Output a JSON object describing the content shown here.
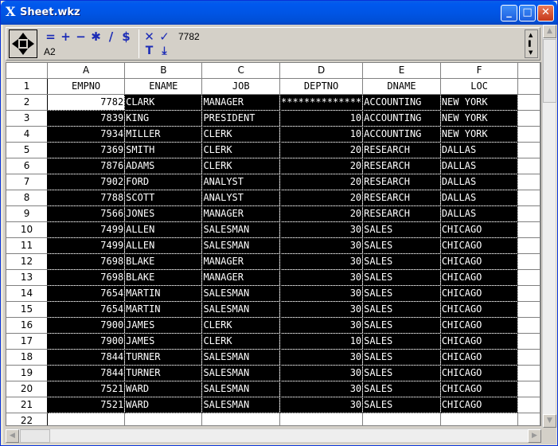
{
  "window": {
    "title": "Sheet.wkz",
    "app_glyph": "X",
    "controls": {
      "minimize": "_",
      "maximize": "□",
      "close": "✕"
    }
  },
  "toolbar": {
    "buttons_top": [
      "=",
      "+",
      "−",
      "✱",
      "/",
      "$",
      "✕",
      "✓"
    ],
    "buttons_bottom": [
      "T",
      "⤓"
    ],
    "formula_value": "7782",
    "cell_ref": "A2"
  },
  "colors": {
    "selection": "#000000",
    "title_bar": "#0055e5",
    "toolbar_icons": "#1c2cb6"
  },
  "sheet": {
    "columns": [
      "A",
      "B",
      "C",
      "D",
      "E",
      "F"
    ],
    "rows": [
      {
        "n": "1",
        "cells": [
          "EMPNO",
          "ENAME",
          "JOB",
          "DEPTNO",
          "DNAME",
          "LOC"
        ]
      },
      {
        "n": "2",
        "cells": [
          "7782",
          "CLARK",
          "MANAGER",
          "**************",
          "ACCOUNTING",
          "NEW YORK"
        ]
      },
      {
        "n": "3",
        "cells": [
          "7839",
          "KING",
          "PRESIDENT",
          "10",
          "ACCOUNTING",
          "NEW YORK"
        ]
      },
      {
        "n": "4",
        "cells": [
          "7934",
          "MILLER",
          "CLERK",
          "10",
          "ACCOUNTING",
          "NEW YORK"
        ]
      },
      {
        "n": "5",
        "cells": [
          "7369",
          "SMITH",
          "CLERK",
          "20",
          "RESEARCH",
          "DALLAS"
        ]
      },
      {
        "n": "6",
        "cells": [
          "7876",
          "ADAMS",
          "CLERK",
          "20",
          "RESEARCH",
          "DALLAS"
        ]
      },
      {
        "n": "7",
        "cells": [
          "7902",
          "FORD",
          "ANALYST",
          "20",
          "RESEARCH",
          "DALLAS"
        ]
      },
      {
        "n": "8",
        "cells": [
          "7788",
          "SCOTT",
          "ANALYST",
          "20",
          "RESEARCH",
          "DALLAS"
        ]
      },
      {
        "n": "9",
        "cells": [
          "7566",
          "JONES",
          "MANAGER",
          "20",
          "RESEARCH",
          "DALLAS"
        ]
      },
      {
        "n": "10",
        "cells": [
          "7499",
          "ALLEN",
          "SALESMAN",
          "30",
          "SALES",
          "CHICAGO"
        ]
      },
      {
        "n": "11",
        "cells": [
          "7499",
          "ALLEN",
          "SALESMAN",
          "30",
          "SALES",
          "CHICAGO"
        ]
      },
      {
        "n": "12",
        "cells": [
          "7698",
          "BLAKE",
          "MANAGER",
          "30",
          "SALES",
          "CHICAGO"
        ]
      },
      {
        "n": "13",
        "cells": [
          "7698",
          "BLAKE",
          "MANAGER",
          "30",
          "SALES",
          "CHICAGO"
        ]
      },
      {
        "n": "14",
        "cells": [
          "7654",
          "MARTIN",
          "SALESMAN",
          "30",
          "SALES",
          "CHICAGO"
        ]
      },
      {
        "n": "15",
        "cells": [
          "7654",
          "MARTIN",
          "SALESMAN",
          "30",
          "SALES",
          "CHICAGO"
        ]
      },
      {
        "n": "16",
        "cells": [
          "7900",
          "JAMES",
          "CLERK",
          "30",
          "SALES",
          "CHICAGO"
        ]
      },
      {
        "n": "17",
        "cells": [
          "7900",
          "JAMES",
          "CLERK",
          "10",
          "SALES",
          "CHICAGO"
        ]
      },
      {
        "n": "18",
        "cells": [
          "7844",
          "TURNER",
          "SALESMAN",
          "30",
          "SALES",
          "CHICAGO"
        ]
      },
      {
        "n": "19",
        "cells": [
          "7844",
          "TURNER",
          "SALESMAN",
          "30",
          "SALES",
          "CHICAGO"
        ]
      },
      {
        "n": "20",
        "cells": [
          "7521",
          "WARD",
          "SALESMAN",
          "30",
          "SALES",
          "CHICAGO"
        ]
      },
      {
        "n": "21",
        "cells": [
          "7521",
          "WARD",
          "SALESMAN",
          "30",
          "SALES",
          "CHICAGO"
        ]
      },
      {
        "n": "22",
        "cells": [
          "",
          "",
          "",
          "",
          "",
          ""
        ]
      }
    ]
  }
}
